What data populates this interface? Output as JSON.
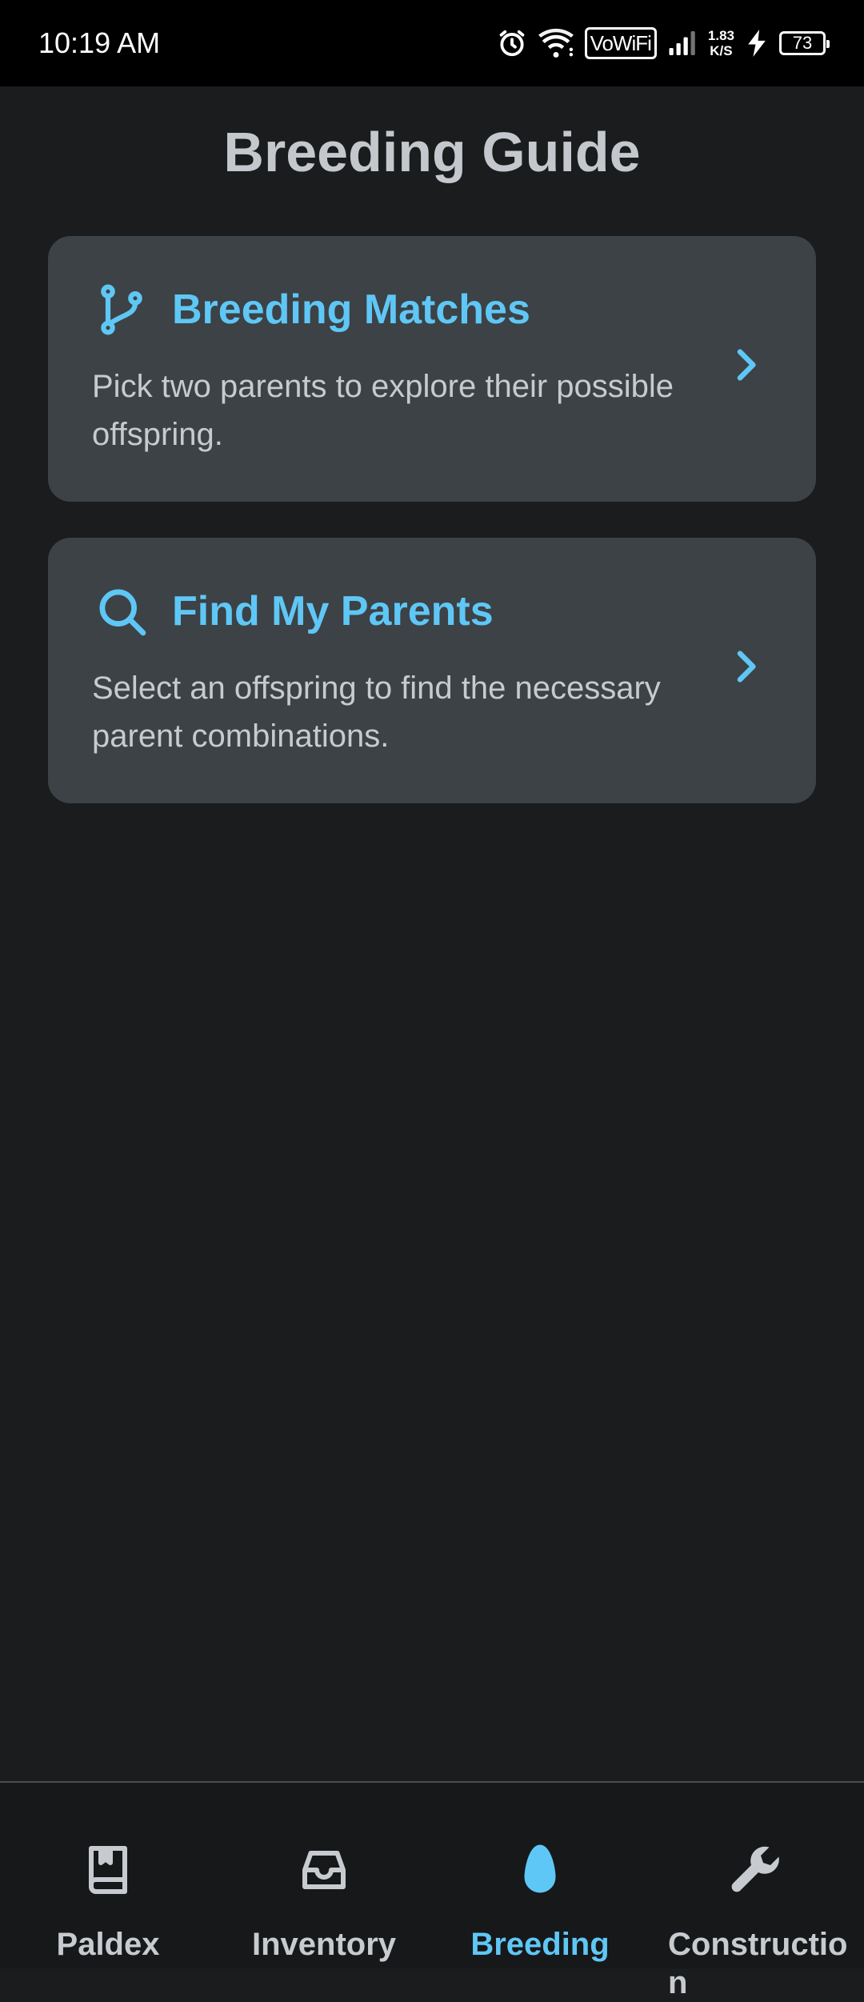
{
  "status_bar": {
    "time": "10:19 AM",
    "vowifi_label": "VoWiFi",
    "speed_value": "1.83",
    "speed_unit": "K/S",
    "battery_level": "73"
  },
  "header": {
    "title": "Breeding Guide"
  },
  "cards": [
    {
      "icon": "git-branch-icon",
      "title": "Breeding Matches",
      "description": "Pick two parents to explore their possible offspring."
    },
    {
      "icon": "search-icon",
      "title": "Find My Parents",
      "description": "Select an offspring to find the necessary parent combinations."
    }
  ],
  "bottom_nav": {
    "items": [
      {
        "label": "Paldex",
        "icon": "book-icon",
        "active": false
      },
      {
        "label": "Inventory",
        "icon": "inbox-icon",
        "active": false
      },
      {
        "label": "Breeding",
        "icon": "egg-icon",
        "active": true
      },
      {
        "label": "Construction",
        "icon": "wrench-icon",
        "active": false
      }
    ]
  },
  "colors": {
    "accent": "#5fc7f5",
    "background": "#1a1c1e",
    "card": "#3c4246",
    "nav_background": "#16181a"
  }
}
